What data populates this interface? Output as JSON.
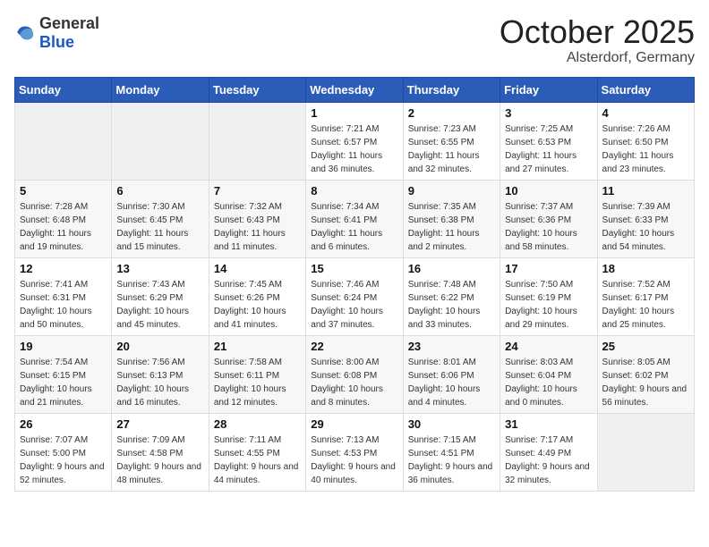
{
  "header": {
    "logo_general": "General",
    "logo_blue": "Blue",
    "month": "October 2025",
    "location": "Alsterdorf, Germany"
  },
  "weekdays": [
    "Sunday",
    "Monday",
    "Tuesday",
    "Wednesday",
    "Thursday",
    "Friday",
    "Saturday"
  ],
  "weeks": [
    [
      {
        "day": "",
        "sunrise": "",
        "sunset": "",
        "daylight": ""
      },
      {
        "day": "",
        "sunrise": "",
        "sunset": "",
        "daylight": ""
      },
      {
        "day": "",
        "sunrise": "",
        "sunset": "",
        "daylight": ""
      },
      {
        "day": "1",
        "sunrise": "Sunrise: 7:21 AM",
        "sunset": "Sunset: 6:57 PM",
        "daylight": "Daylight: 11 hours and 36 minutes."
      },
      {
        "day": "2",
        "sunrise": "Sunrise: 7:23 AM",
        "sunset": "Sunset: 6:55 PM",
        "daylight": "Daylight: 11 hours and 32 minutes."
      },
      {
        "day": "3",
        "sunrise": "Sunrise: 7:25 AM",
        "sunset": "Sunset: 6:53 PM",
        "daylight": "Daylight: 11 hours and 27 minutes."
      },
      {
        "day": "4",
        "sunrise": "Sunrise: 7:26 AM",
        "sunset": "Sunset: 6:50 PM",
        "daylight": "Daylight: 11 hours and 23 minutes."
      }
    ],
    [
      {
        "day": "5",
        "sunrise": "Sunrise: 7:28 AM",
        "sunset": "Sunset: 6:48 PM",
        "daylight": "Daylight: 11 hours and 19 minutes."
      },
      {
        "day": "6",
        "sunrise": "Sunrise: 7:30 AM",
        "sunset": "Sunset: 6:45 PM",
        "daylight": "Daylight: 11 hours and 15 minutes."
      },
      {
        "day": "7",
        "sunrise": "Sunrise: 7:32 AM",
        "sunset": "Sunset: 6:43 PM",
        "daylight": "Daylight: 11 hours and 11 minutes."
      },
      {
        "day": "8",
        "sunrise": "Sunrise: 7:34 AM",
        "sunset": "Sunset: 6:41 PM",
        "daylight": "Daylight: 11 hours and 6 minutes."
      },
      {
        "day": "9",
        "sunrise": "Sunrise: 7:35 AM",
        "sunset": "Sunset: 6:38 PM",
        "daylight": "Daylight: 11 hours and 2 minutes."
      },
      {
        "day": "10",
        "sunrise": "Sunrise: 7:37 AM",
        "sunset": "Sunset: 6:36 PM",
        "daylight": "Daylight: 10 hours and 58 minutes."
      },
      {
        "day": "11",
        "sunrise": "Sunrise: 7:39 AM",
        "sunset": "Sunset: 6:33 PM",
        "daylight": "Daylight: 10 hours and 54 minutes."
      }
    ],
    [
      {
        "day": "12",
        "sunrise": "Sunrise: 7:41 AM",
        "sunset": "Sunset: 6:31 PM",
        "daylight": "Daylight: 10 hours and 50 minutes."
      },
      {
        "day": "13",
        "sunrise": "Sunrise: 7:43 AM",
        "sunset": "Sunset: 6:29 PM",
        "daylight": "Daylight: 10 hours and 45 minutes."
      },
      {
        "day": "14",
        "sunrise": "Sunrise: 7:45 AM",
        "sunset": "Sunset: 6:26 PM",
        "daylight": "Daylight: 10 hours and 41 minutes."
      },
      {
        "day": "15",
        "sunrise": "Sunrise: 7:46 AM",
        "sunset": "Sunset: 6:24 PM",
        "daylight": "Daylight: 10 hours and 37 minutes."
      },
      {
        "day": "16",
        "sunrise": "Sunrise: 7:48 AM",
        "sunset": "Sunset: 6:22 PM",
        "daylight": "Daylight: 10 hours and 33 minutes."
      },
      {
        "day": "17",
        "sunrise": "Sunrise: 7:50 AM",
        "sunset": "Sunset: 6:19 PM",
        "daylight": "Daylight: 10 hours and 29 minutes."
      },
      {
        "day": "18",
        "sunrise": "Sunrise: 7:52 AM",
        "sunset": "Sunset: 6:17 PM",
        "daylight": "Daylight: 10 hours and 25 minutes."
      }
    ],
    [
      {
        "day": "19",
        "sunrise": "Sunrise: 7:54 AM",
        "sunset": "Sunset: 6:15 PM",
        "daylight": "Daylight: 10 hours and 21 minutes."
      },
      {
        "day": "20",
        "sunrise": "Sunrise: 7:56 AM",
        "sunset": "Sunset: 6:13 PM",
        "daylight": "Daylight: 10 hours and 16 minutes."
      },
      {
        "day": "21",
        "sunrise": "Sunrise: 7:58 AM",
        "sunset": "Sunset: 6:11 PM",
        "daylight": "Daylight: 10 hours and 12 minutes."
      },
      {
        "day": "22",
        "sunrise": "Sunrise: 8:00 AM",
        "sunset": "Sunset: 6:08 PM",
        "daylight": "Daylight: 10 hours and 8 minutes."
      },
      {
        "day": "23",
        "sunrise": "Sunrise: 8:01 AM",
        "sunset": "Sunset: 6:06 PM",
        "daylight": "Daylight: 10 hours and 4 minutes."
      },
      {
        "day": "24",
        "sunrise": "Sunrise: 8:03 AM",
        "sunset": "Sunset: 6:04 PM",
        "daylight": "Daylight: 10 hours and 0 minutes."
      },
      {
        "day": "25",
        "sunrise": "Sunrise: 8:05 AM",
        "sunset": "Sunset: 6:02 PM",
        "daylight": "Daylight: 9 hours and 56 minutes."
      }
    ],
    [
      {
        "day": "26",
        "sunrise": "Sunrise: 7:07 AM",
        "sunset": "Sunset: 5:00 PM",
        "daylight": "Daylight: 9 hours and 52 minutes."
      },
      {
        "day": "27",
        "sunrise": "Sunrise: 7:09 AM",
        "sunset": "Sunset: 4:58 PM",
        "daylight": "Daylight: 9 hours and 48 minutes."
      },
      {
        "day": "28",
        "sunrise": "Sunrise: 7:11 AM",
        "sunset": "Sunset: 4:55 PM",
        "daylight": "Daylight: 9 hours and 44 minutes."
      },
      {
        "day": "29",
        "sunrise": "Sunrise: 7:13 AM",
        "sunset": "Sunset: 4:53 PM",
        "daylight": "Daylight: 9 hours and 40 minutes."
      },
      {
        "day": "30",
        "sunrise": "Sunrise: 7:15 AM",
        "sunset": "Sunset: 4:51 PM",
        "daylight": "Daylight: 9 hours and 36 minutes."
      },
      {
        "day": "31",
        "sunrise": "Sunrise: 7:17 AM",
        "sunset": "Sunset: 4:49 PM",
        "daylight": "Daylight: 9 hours and 32 minutes."
      },
      {
        "day": "",
        "sunrise": "",
        "sunset": "",
        "daylight": ""
      }
    ]
  ]
}
